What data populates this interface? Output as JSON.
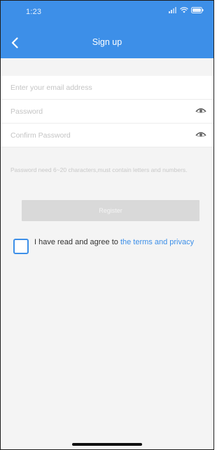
{
  "status_bar": {
    "time": "1:23",
    "icons": [
      "signal-icon",
      "wifi-icon",
      "battery-icon"
    ]
  },
  "nav": {
    "title": "Sign up",
    "back_icon": "chevron-left-icon"
  },
  "form": {
    "email_placeholder": "Enter your email address",
    "email_value": "",
    "password_placeholder": "Password",
    "password_value": "",
    "confirm_placeholder": "Confirm Password",
    "confirm_value": "",
    "password_toggle_icon": "eye-icon",
    "hint": "Password need 6~20 characters,must contain letters and numbers.",
    "register_label": "Register"
  },
  "agreement": {
    "prefix": "I have read and agree to ",
    "link_text": "the terms and privacy",
    "checked": false
  },
  "colors": {
    "accent": "#3d8fe8",
    "page_background": "#f4f4f4",
    "disabled_button": "#d9d9d9",
    "placeholder_text": "#c4c4c4"
  }
}
